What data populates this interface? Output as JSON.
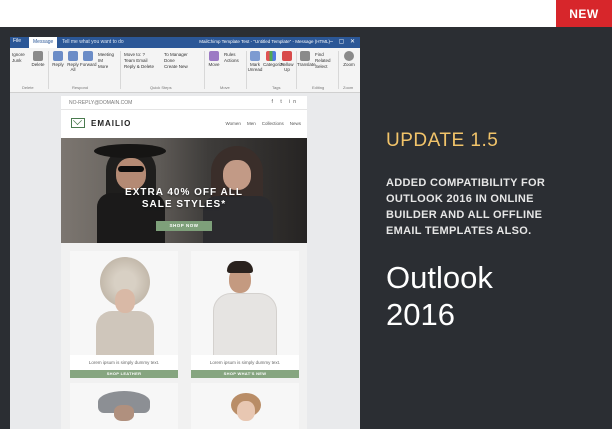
{
  "badge": "NEW",
  "outlook": {
    "tabs": {
      "file": "File",
      "message": "Message",
      "tell": "Tell me what you want to do"
    },
    "window_title": "MailChimp Template Test - \"Untitled Template\" - Message (HTML)",
    "ribbon": {
      "delete_group": {
        "ignore": "Ignore",
        "junk": "Junk",
        "delete": "Delete",
        "label": "Delete"
      },
      "respond_group": {
        "reply": "Reply",
        "reply_all": "Reply All",
        "forward": "Forward",
        "meeting": "Meeting",
        "im": "IM",
        "more": "More",
        "label": "Respond"
      },
      "quick_steps": {
        "items": [
          "Move to: ?",
          "Team Email",
          "Reply & Delete",
          "To Manager",
          "Done",
          "Create New"
        ],
        "label": "Quick Steps"
      },
      "move_group": {
        "move": "Move",
        "rules": "Rules",
        "actions": "Actions",
        "label": "Move"
      },
      "tags_group": {
        "unread": "Mark Unread",
        "categorize": "Categorize",
        "follow": "Follow Up",
        "label": "Tags"
      },
      "editing_group": {
        "translate": "Translate",
        "find": "Find",
        "related": "Related",
        "select": "Select",
        "label": "Editing"
      },
      "zoom_group": {
        "zoom": "Zoom",
        "label": "Zoom"
      }
    }
  },
  "email": {
    "noreply": "NO-REPLY@DOMAIN.COM",
    "social": "f t in",
    "brand": "EMAILIO",
    "nav": [
      "Women",
      "Men",
      "Collections",
      "News"
    ],
    "hero_line1": "EXTRA 40% OFF ALL",
    "hero_line2": "SALE STYLES*",
    "hero_button": "SHOP NOW",
    "products": [
      {
        "desc": "Lorem ipsum is simply dummy text.",
        "button": "SHOP LEATHER"
      },
      {
        "desc": "Lorem ipsum is simply dummy text.",
        "button": "SHOP WHAT'S NEW"
      }
    ]
  },
  "promo": {
    "title": "UPDATE 1.5",
    "description": "ADDED COMPATIBILITY FOR OUTLOOK 2016 IN ONLINE BUILDER AND ALL OFFLINE EMAIL TEMPLATES ALSO.",
    "headline_line1": "Outlook",
    "headline_line2": "2016"
  },
  "colors": {
    "accent_red": "#d7262b",
    "title_gold": "#f2c46a",
    "background": "#2b2e33",
    "outlook_blue": "#2b5797",
    "button_green": "#86a580"
  }
}
